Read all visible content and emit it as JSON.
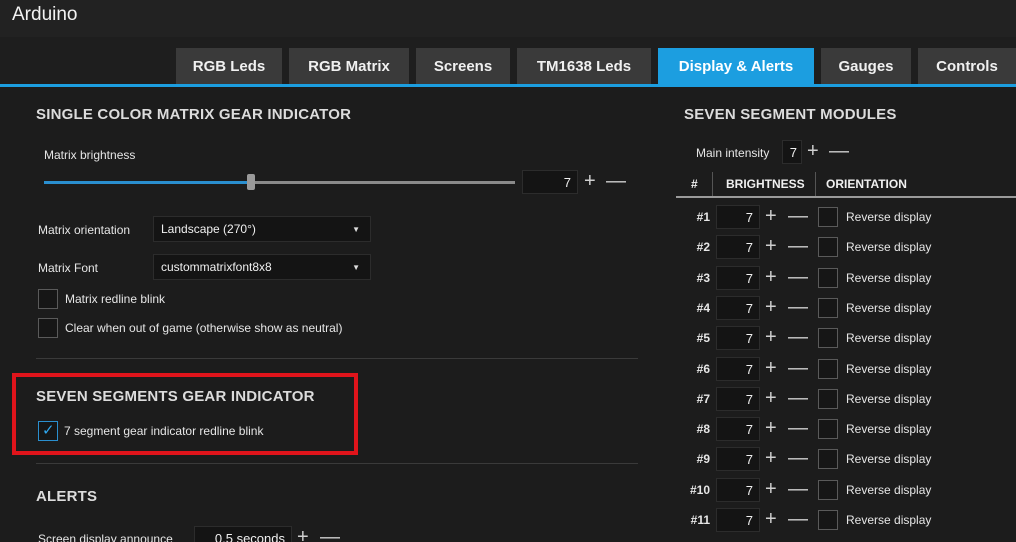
{
  "app": {
    "title": "Arduino"
  },
  "tabs": [
    {
      "label": "RGB Leds",
      "active": false
    },
    {
      "label": "RGB Matrix",
      "active": false
    },
    {
      "label": "Screens",
      "active": false
    },
    {
      "label": "TM1638 Leds",
      "active": false
    },
    {
      "label": "Display & Alerts",
      "active": true
    },
    {
      "label": "Gauges",
      "active": false
    },
    {
      "label": "Controls",
      "active": false
    }
  ],
  "matrix_section": {
    "title": "SINGLE COLOR MATRIX GEAR INDICATOR",
    "brightness_label": "Matrix brightness",
    "brightness_value": "7",
    "brightness_level": 0.5,
    "orientation_label": "Matrix orientation",
    "orientation_value": "Landscape (270°)",
    "font_label": "Matrix Font",
    "font_value": "custommatrixfont8x8",
    "redline_blink_label": "Matrix redline blink",
    "redline_blink_checked": false,
    "clear_label": "Clear when out of game (otherwise show as neutral)",
    "clear_checked": false
  },
  "seven_seg_section": {
    "title": "SEVEN SEGMENTS GEAR INDICATOR",
    "redline_label": "7 segment gear indicator redline blink",
    "redline_checked": true
  },
  "alerts_section": {
    "title": "ALERTS",
    "announce_label": "Screen display announce",
    "announce_value": "0.5 seconds"
  },
  "modules_section": {
    "title": "SEVEN SEGMENT MODULES",
    "main_intensity_label": "Main intensity",
    "main_intensity_value": "7",
    "columns": [
      "#",
      "BRIGHTNESS",
      "ORIENTATION"
    ],
    "rows": [
      {
        "num": "#1",
        "brightness": "7",
        "orientation_label": "Reverse display"
      },
      {
        "num": "#2",
        "brightness": "7",
        "orientation_label": "Reverse display"
      },
      {
        "num": "#3",
        "brightness": "7",
        "orientation_label": "Reverse display"
      },
      {
        "num": "#4",
        "brightness": "7",
        "orientation_label": "Reverse display"
      },
      {
        "num": "#5",
        "brightness": "7",
        "orientation_label": "Reverse display"
      },
      {
        "num": "#6",
        "brightness": "7",
        "orientation_label": "Reverse display"
      },
      {
        "num": "#7",
        "brightness": "7",
        "orientation_label": "Reverse display"
      },
      {
        "num": "#8",
        "brightness": "7",
        "orientation_label": "Reverse display"
      },
      {
        "num": "#9",
        "brightness": "7",
        "orientation_label": "Reverse display"
      },
      {
        "num": "#10",
        "brightness": "7",
        "orientation_label": "Reverse display"
      },
      {
        "num": "#11",
        "brightness": "7",
        "orientation_label": "Reverse display"
      }
    ]
  },
  "controls": {
    "plus_symbol": "+",
    "minus_symbol": "—"
  },
  "colors": {
    "accent": "#1c9ee0",
    "highlight_border": "#e0141b",
    "background": "#1c1c1c"
  }
}
